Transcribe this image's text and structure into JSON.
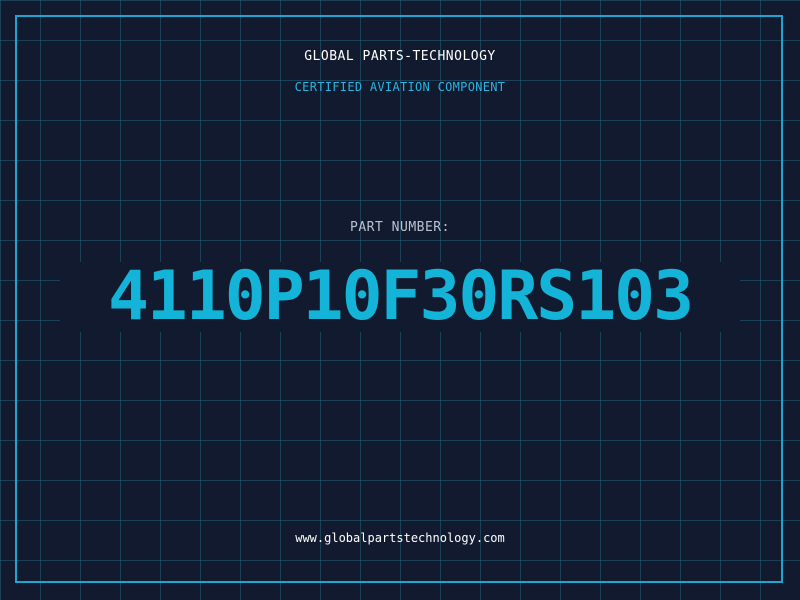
{
  "header": {
    "company": "GLOBAL PARTS-TECHNOLOGY",
    "subtitle": "CERTIFIED AVIATION COMPONENT"
  },
  "part": {
    "label": "PART NUMBER:",
    "number": "4110P10F30RS103"
  },
  "footer": {
    "website": "www.globalpartstechnology.com"
  },
  "colors": {
    "background": "#111a2e",
    "grid": "#286e8c",
    "accent": "#1da6cf",
    "part_number": "#14b4d8"
  }
}
